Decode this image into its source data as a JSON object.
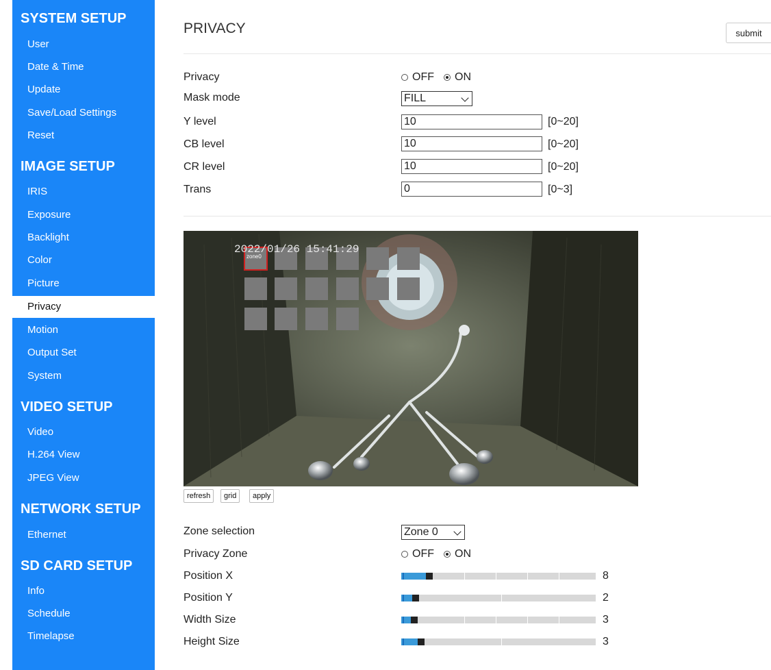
{
  "sidebar": {
    "sections": [
      {
        "title": "SYSTEM SETUP",
        "items": [
          "User",
          "Date & Time",
          "Update",
          "Save/Load Settings",
          "Reset"
        ]
      },
      {
        "title": "IMAGE SETUP",
        "items": [
          "IRIS",
          "Exposure",
          "Backlight",
          "Color",
          "Picture",
          "Privacy",
          "Motion",
          "Output Set",
          "System"
        ]
      },
      {
        "title": "VIDEO SETUP",
        "items": [
          "Video",
          "H.264 View",
          "JPEG View"
        ]
      },
      {
        "title": "NETWORK SETUP",
        "items": [
          "Ethernet"
        ]
      },
      {
        "title": "SD CARD SETUP",
        "items": [
          "Info",
          "Schedule",
          "Timelapse"
        ]
      }
    ],
    "active_item": "Privacy",
    "accent": "#1a86f8"
  },
  "page": {
    "title": "PRIVACY",
    "submit_label": "submit"
  },
  "settings": {
    "privacy": {
      "label": "Privacy",
      "options": [
        "OFF",
        "ON"
      ],
      "selected": "ON"
    },
    "mask_mode": {
      "label": "Mask mode",
      "value": "FILL"
    },
    "y_level": {
      "label": "Y level",
      "value": "10",
      "range": "[0~20]"
    },
    "cb_level": {
      "label": "CB level",
      "value": "10",
      "range": "[0~20]"
    },
    "cr_level": {
      "label": "CR level",
      "value": "10",
      "range": "[0~20]"
    },
    "trans": {
      "label": "Trans",
      "value": "0",
      "range": "[0~3]"
    }
  },
  "video": {
    "timestamp": "2022/01/26 15:41:29",
    "zone_label": "zone0"
  },
  "video_buttons": {
    "refresh": "refresh",
    "grid": "grid",
    "apply": "apply"
  },
  "zone": {
    "zone_selection": {
      "label": "Zone selection",
      "value": "Zone 0"
    },
    "privacy_zone": {
      "label": "Privacy Zone",
      "options": [
        "OFF",
        "ON"
      ],
      "selected": "ON"
    },
    "position_x": {
      "label": "Position X",
      "value": "8"
    },
    "position_y": {
      "label": "Position Y",
      "value": "2"
    },
    "width_size": {
      "label": "Width Size",
      "value": "3"
    },
    "height_size": {
      "label": "Height Size",
      "value": "3"
    }
  }
}
